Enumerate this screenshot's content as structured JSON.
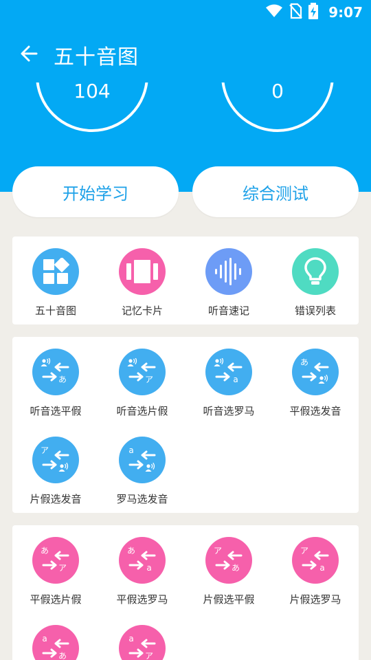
{
  "status": {
    "time": "9:07"
  },
  "appbar": {
    "title": "五十音图"
  },
  "stats": {
    "left_value": "104",
    "right_value": "0"
  },
  "actions": {
    "start_label": "开始学习",
    "test_label": "综合测试"
  },
  "tools": [
    {
      "label": "五十音图",
      "icon": "grid-icon",
      "color": "#42aef0"
    },
    {
      "label": "记忆卡片",
      "icon": "cards-icon",
      "color": "#f660ab"
    },
    {
      "label": "听音速记",
      "icon": "waveform-icon",
      "color": "#6d9cf6"
    },
    {
      "label": "错误列表",
      "icon": "lightbulb-icon",
      "color": "#4fdbc2"
    }
  ],
  "listen_modes": [
    {
      "label": "听音选平假",
      "from": "sound",
      "to": "あ"
    },
    {
      "label": "听音选片假",
      "from": "sound",
      "to": "ア"
    },
    {
      "label": "听音选罗马",
      "from": "sound",
      "to": "a"
    },
    {
      "label": "平假选发音",
      "from": "あ",
      "to": "sound"
    },
    {
      "label": "片假选发音",
      "from": "ア",
      "to": "sound"
    },
    {
      "label": "罗马选发音",
      "from": "a",
      "to": "sound"
    }
  ],
  "kana_modes": [
    {
      "label": "平假选片假",
      "from": "あ",
      "to": "ア"
    },
    {
      "label": "平假选罗马",
      "from": "あ",
      "to": "a"
    },
    {
      "label": "片假选平假",
      "from": "ア",
      "to": "あ"
    },
    {
      "label": "片假选罗马",
      "from": "ア",
      "to": "a"
    },
    {
      "label": "",
      "from": "a",
      "to": "あ"
    },
    {
      "label": "",
      "from": "a",
      "to": "ア"
    }
  ]
}
